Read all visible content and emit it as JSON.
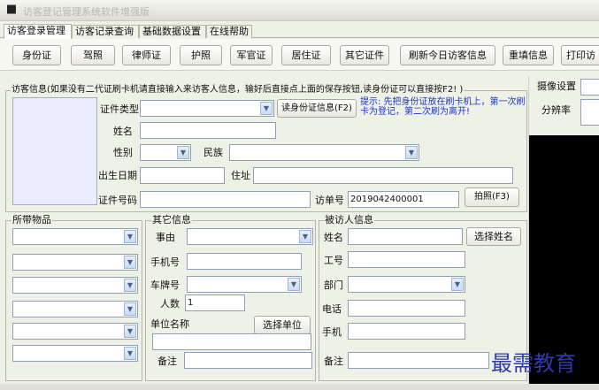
{
  "window": {
    "title": "访客登记管理系统软件增强版"
  },
  "tabs": [
    "访客登录管理",
    "访客记录查询",
    "基础数据设置",
    "在线帮助"
  ],
  "toolbar": {
    "id_card": "身份证",
    "driver_license": "驾照",
    "lawyer_cert": "律师证",
    "passport": "护照",
    "military_cert": "军官证",
    "residence_permit": "居住证",
    "other_cert": "其它证件",
    "refresh": "刷新今日访客信息",
    "refill": "重填信息",
    "print": "打印访"
  },
  "visitor": {
    "section_title": "访客信息(如果没有二代证刷卡机请直接输入来访客人信息，输好后直接点上面的保存按钮,读身份证可以直接按F2! )",
    "cert_type_label": "证件类型",
    "cert_type": "",
    "read_id_button": "读身份证信息(F2)",
    "hint": "提示: 先把身份证放在刷卡机上，第一次刷卡为登记，第二次刷为离开!",
    "name_label": "姓名",
    "name": "",
    "gender_label": "性别",
    "gender": "",
    "ethnicity_label": "民族",
    "ethnicity": "",
    "birthdate_label": "出生日期",
    "birthdate": "",
    "address_label": "住址",
    "address": "",
    "cert_number_label": "证件号码",
    "cert_number": "",
    "visit_number_label": "访单号",
    "visit_number": "2019042400001",
    "photo_button": "拍照(F3)"
  },
  "belongings": {
    "title": "所带物品"
  },
  "other": {
    "title": "其它信息",
    "reason_label": "事由",
    "reason": "",
    "phone_label": "手机号",
    "phone": "",
    "plate_label": "车牌号",
    "plate": "",
    "count_label": "人数",
    "count": "1",
    "company_label": "单位名称",
    "company": "",
    "select_company_button": "选择单位",
    "remark_label": "备注",
    "remark": ""
  },
  "visitee": {
    "title": "被访人信息",
    "name_label": "姓名",
    "name": "",
    "select_name_button": "选择姓名",
    "employee_id_label": "工号",
    "employee_id": "",
    "dept_label": "部门",
    "dept": "",
    "tel_label": "电话",
    "tel": "",
    "mobile_label": "手机",
    "mobile": "",
    "remark_label": "备注",
    "remark": ""
  },
  "camera": {
    "settings_label": "摄像设置",
    "resolution_label": "分辨率"
  },
  "watermark": "最需教育",
  "colors": {
    "hint": "#1a33d0",
    "camera_bg": "#000000",
    "watermark": "#2e3aa8"
  }
}
